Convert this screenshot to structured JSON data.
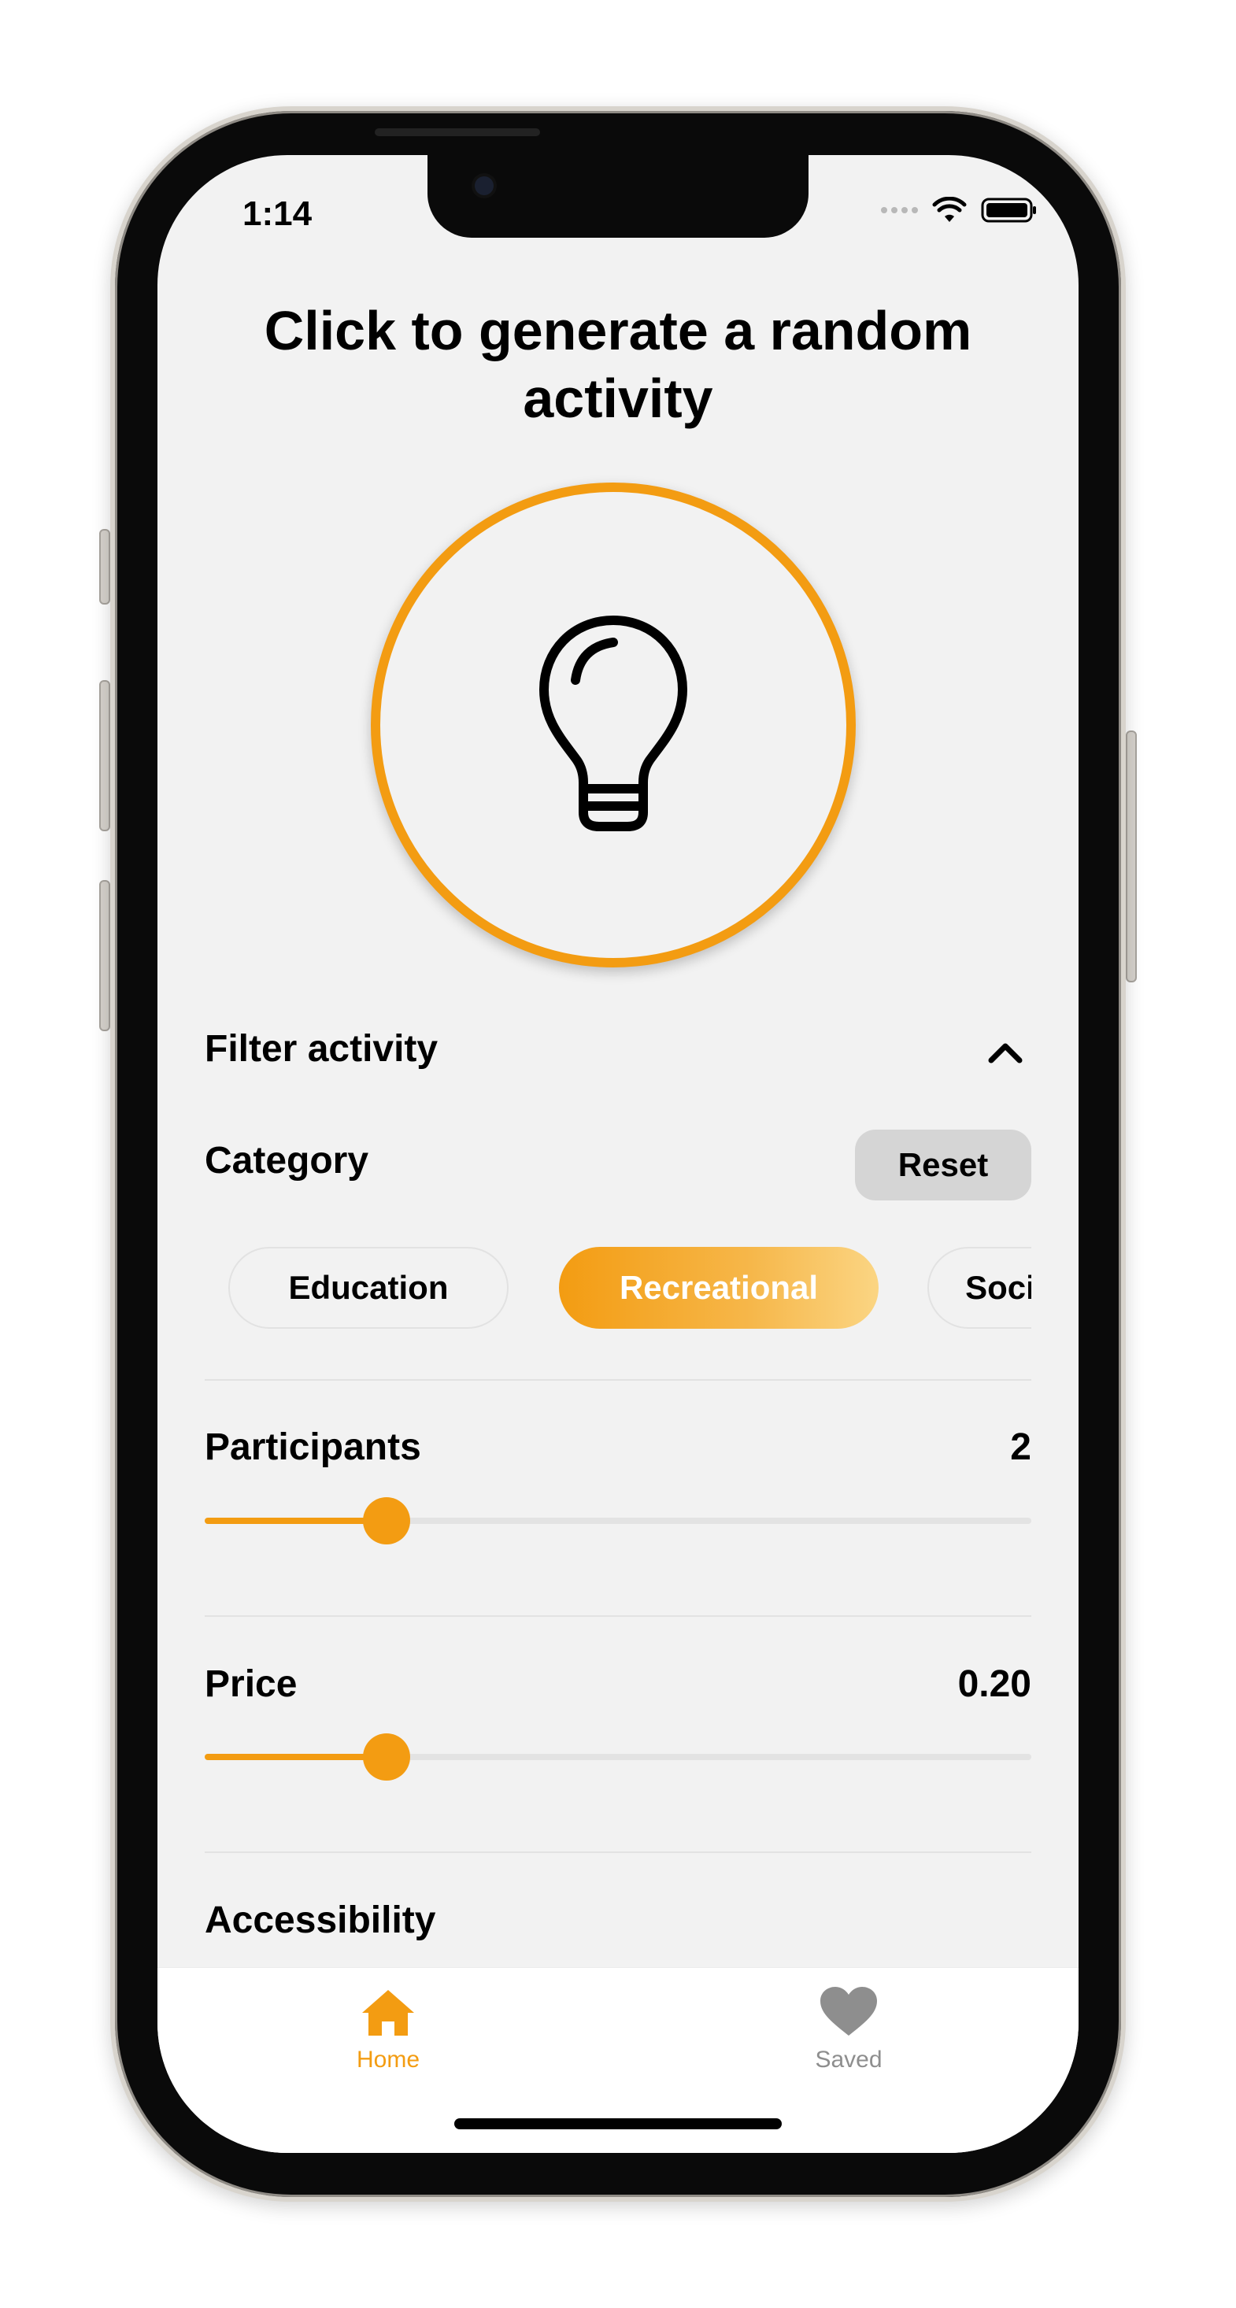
{
  "status_bar": {
    "time": "1:14"
  },
  "header": {
    "title_line1": "Click to generate a random",
    "title_line2": "activity"
  },
  "generate_button": {
    "icon": "lightbulb-icon",
    "accent": "#f39c12"
  },
  "filter": {
    "heading": "Filter activity",
    "expanded": true,
    "category": {
      "label": "Category",
      "reset_label": "Reset",
      "chips": [
        {
          "label": "Education",
          "selected": false
        },
        {
          "label": "Recreational",
          "selected": true
        },
        {
          "label": "Social",
          "selected": false
        }
      ]
    },
    "participants": {
      "label": "Participants",
      "value": "2",
      "fraction": 0.22
    },
    "price": {
      "label": "Price",
      "value": "0.20",
      "fraction": 0.22
    },
    "accessibility": {
      "label": "Accessibility"
    }
  },
  "tabbar": {
    "tabs": [
      {
        "label": "Home",
        "icon": "home-icon",
        "active": true,
        "color": "#f39c12"
      },
      {
        "label": "Saved",
        "icon": "heart-icon",
        "active": false,
        "color": "#8e8e8e"
      }
    ]
  }
}
